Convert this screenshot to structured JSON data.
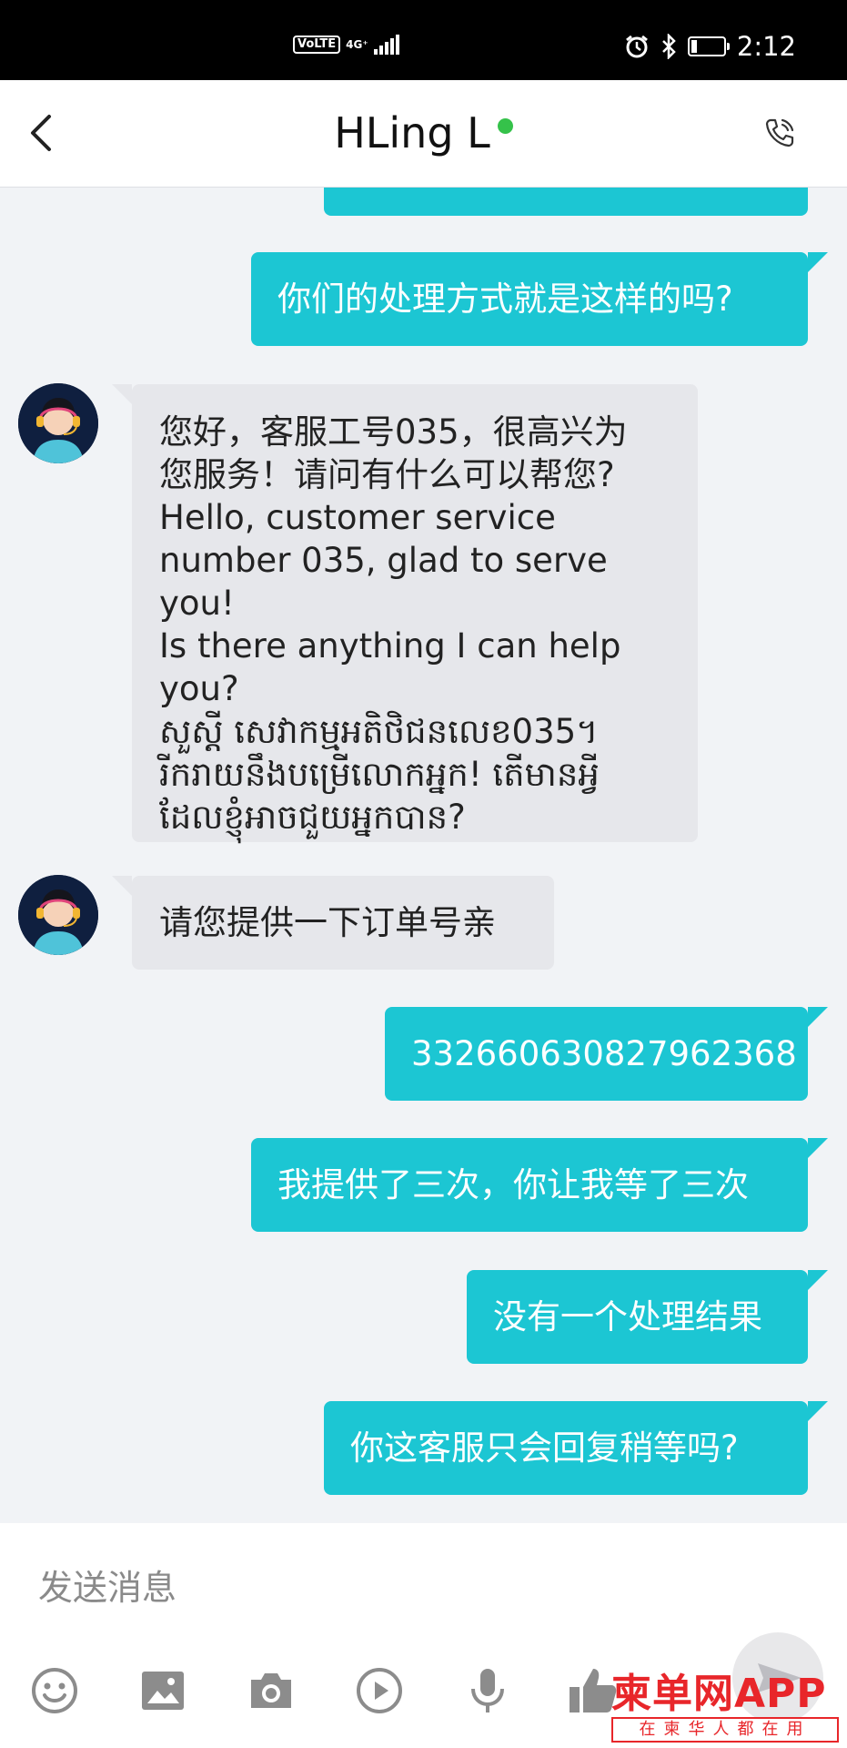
{
  "status_bar": {
    "network_label": "VoLTE",
    "signal_label": "4G⁺",
    "time": "2:12"
  },
  "header": {
    "title": "HLing L"
  },
  "messages": [
    {
      "from": "me",
      "text": ""
    },
    {
      "from": "me",
      "text": "你们的处理方式就是这样的吗?"
    },
    {
      "from": "agent",
      "lines": [
        "您好，客服工号035，很高兴为",
        "您服务！请问有什么可以帮您?",
        "Hello, customer service",
        "number 035, glad to serve you!",
        "Is there anything I can help",
        "you?",
        "សួស្តី សេវាកម្មអតិថិជនលេខ035។",
        "រីករាយនឹងបម្រើលោកអ្នក! តើមានអ្វី",
        "ដែលខ្ញុំអាចជួយអ្នកបាន?"
      ]
    },
    {
      "from": "agent",
      "text": "请您提供一下订单号亲"
    },
    {
      "from": "me",
      "text": "332660630827962368"
    },
    {
      "from": "me",
      "text": "我提供了三次，你让我等了三次"
    },
    {
      "from": "me",
      "text": "没有一个处理结果"
    },
    {
      "from": "me",
      "text": "你这客服只会回复稍等吗?"
    }
  ],
  "composer": {
    "placeholder": "发送消息"
  },
  "toolbar": {
    "icons": [
      "emoji-icon",
      "image-icon",
      "camera-icon",
      "video-icon",
      "mic-icon",
      "thumbs-up-icon",
      "send-icon"
    ]
  },
  "watermark": {
    "brand": "柬单网APP",
    "tagline": "在柬华人都在用"
  },
  "colors": {
    "outgoing_bubble": "#1cc6d3",
    "incoming_bubble": "#e6e7eb",
    "online_dot": "#35c24a",
    "watermark": "#e8262a"
  }
}
